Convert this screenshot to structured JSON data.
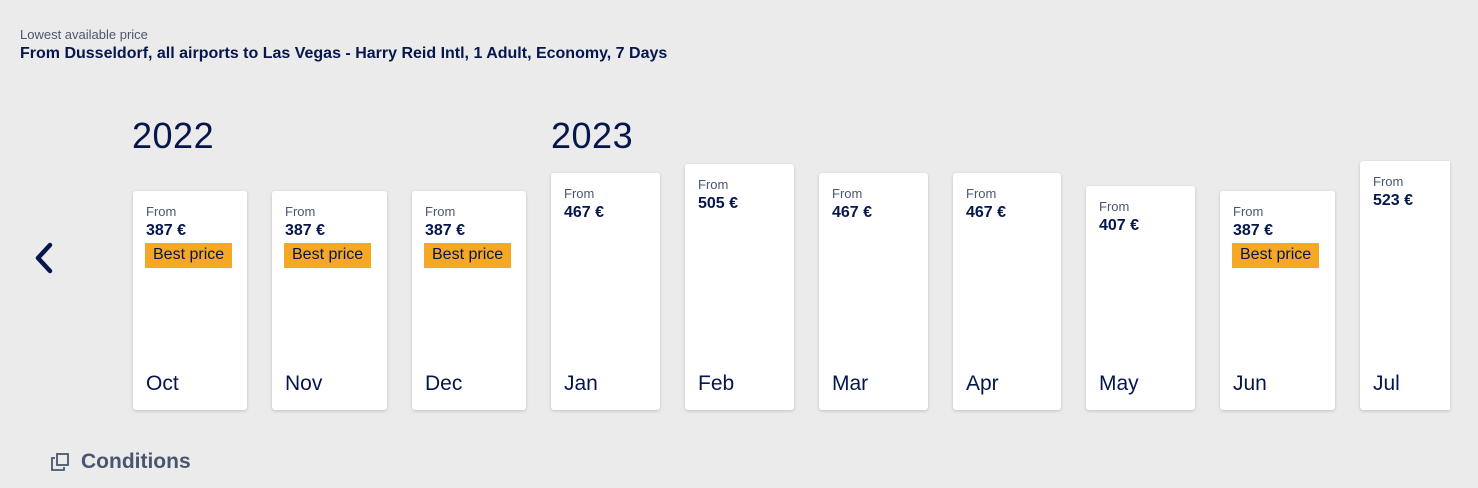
{
  "header": {
    "label": "Lowest available price",
    "route": "From Dusseldorf, all airports to Las Vegas - Harry Reid Intl, 1 Adult, Economy, 7 Days"
  },
  "years": [
    "2022",
    "2023"
  ],
  "navigation": {
    "prev_icon": "chevron-left-icon"
  },
  "months": [
    {
      "from": "From",
      "price": "387 €",
      "badge": "Best price",
      "month": "Oct"
    },
    {
      "from": "From",
      "price": "387 €",
      "badge": "Best price",
      "month": "Nov"
    },
    {
      "from": "From",
      "price": "387 €",
      "badge": "Best price",
      "month": "Dec"
    },
    {
      "from": "From",
      "price": "467 €",
      "badge": null,
      "month": "Jan"
    },
    {
      "from": "From",
      "price": "505 €",
      "badge": null,
      "month": "Feb"
    },
    {
      "from": "From",
      "price": "467 €",
      "badge": null,
      "month": "Mar"
    },
    {
      "from": "From",
      "price": "467 €",
      "badge": null,
      "month": "Apr"
    },
    {
      "from": "From",
      "price": "407 €",
      "badge": null,
      "month": "May"
    },
    {
      "from": "From",
      "price": "387 €",
      "badge": "Best price",
      "month": "Jun"
    },
    {
      "from": "From",
      "price": "523 €",
      "badge": null,
      "month": "Jul"
    }
  ],
  "conditions": {
    "label": "Conditions",
    "icon": "external-window-icon"
  },
  "colors": {
    "background": "#ebebeb",
    "navy": "#05164d",
    "badge": "#f7a823",
    "muted": "#4a5670"
  }
}
